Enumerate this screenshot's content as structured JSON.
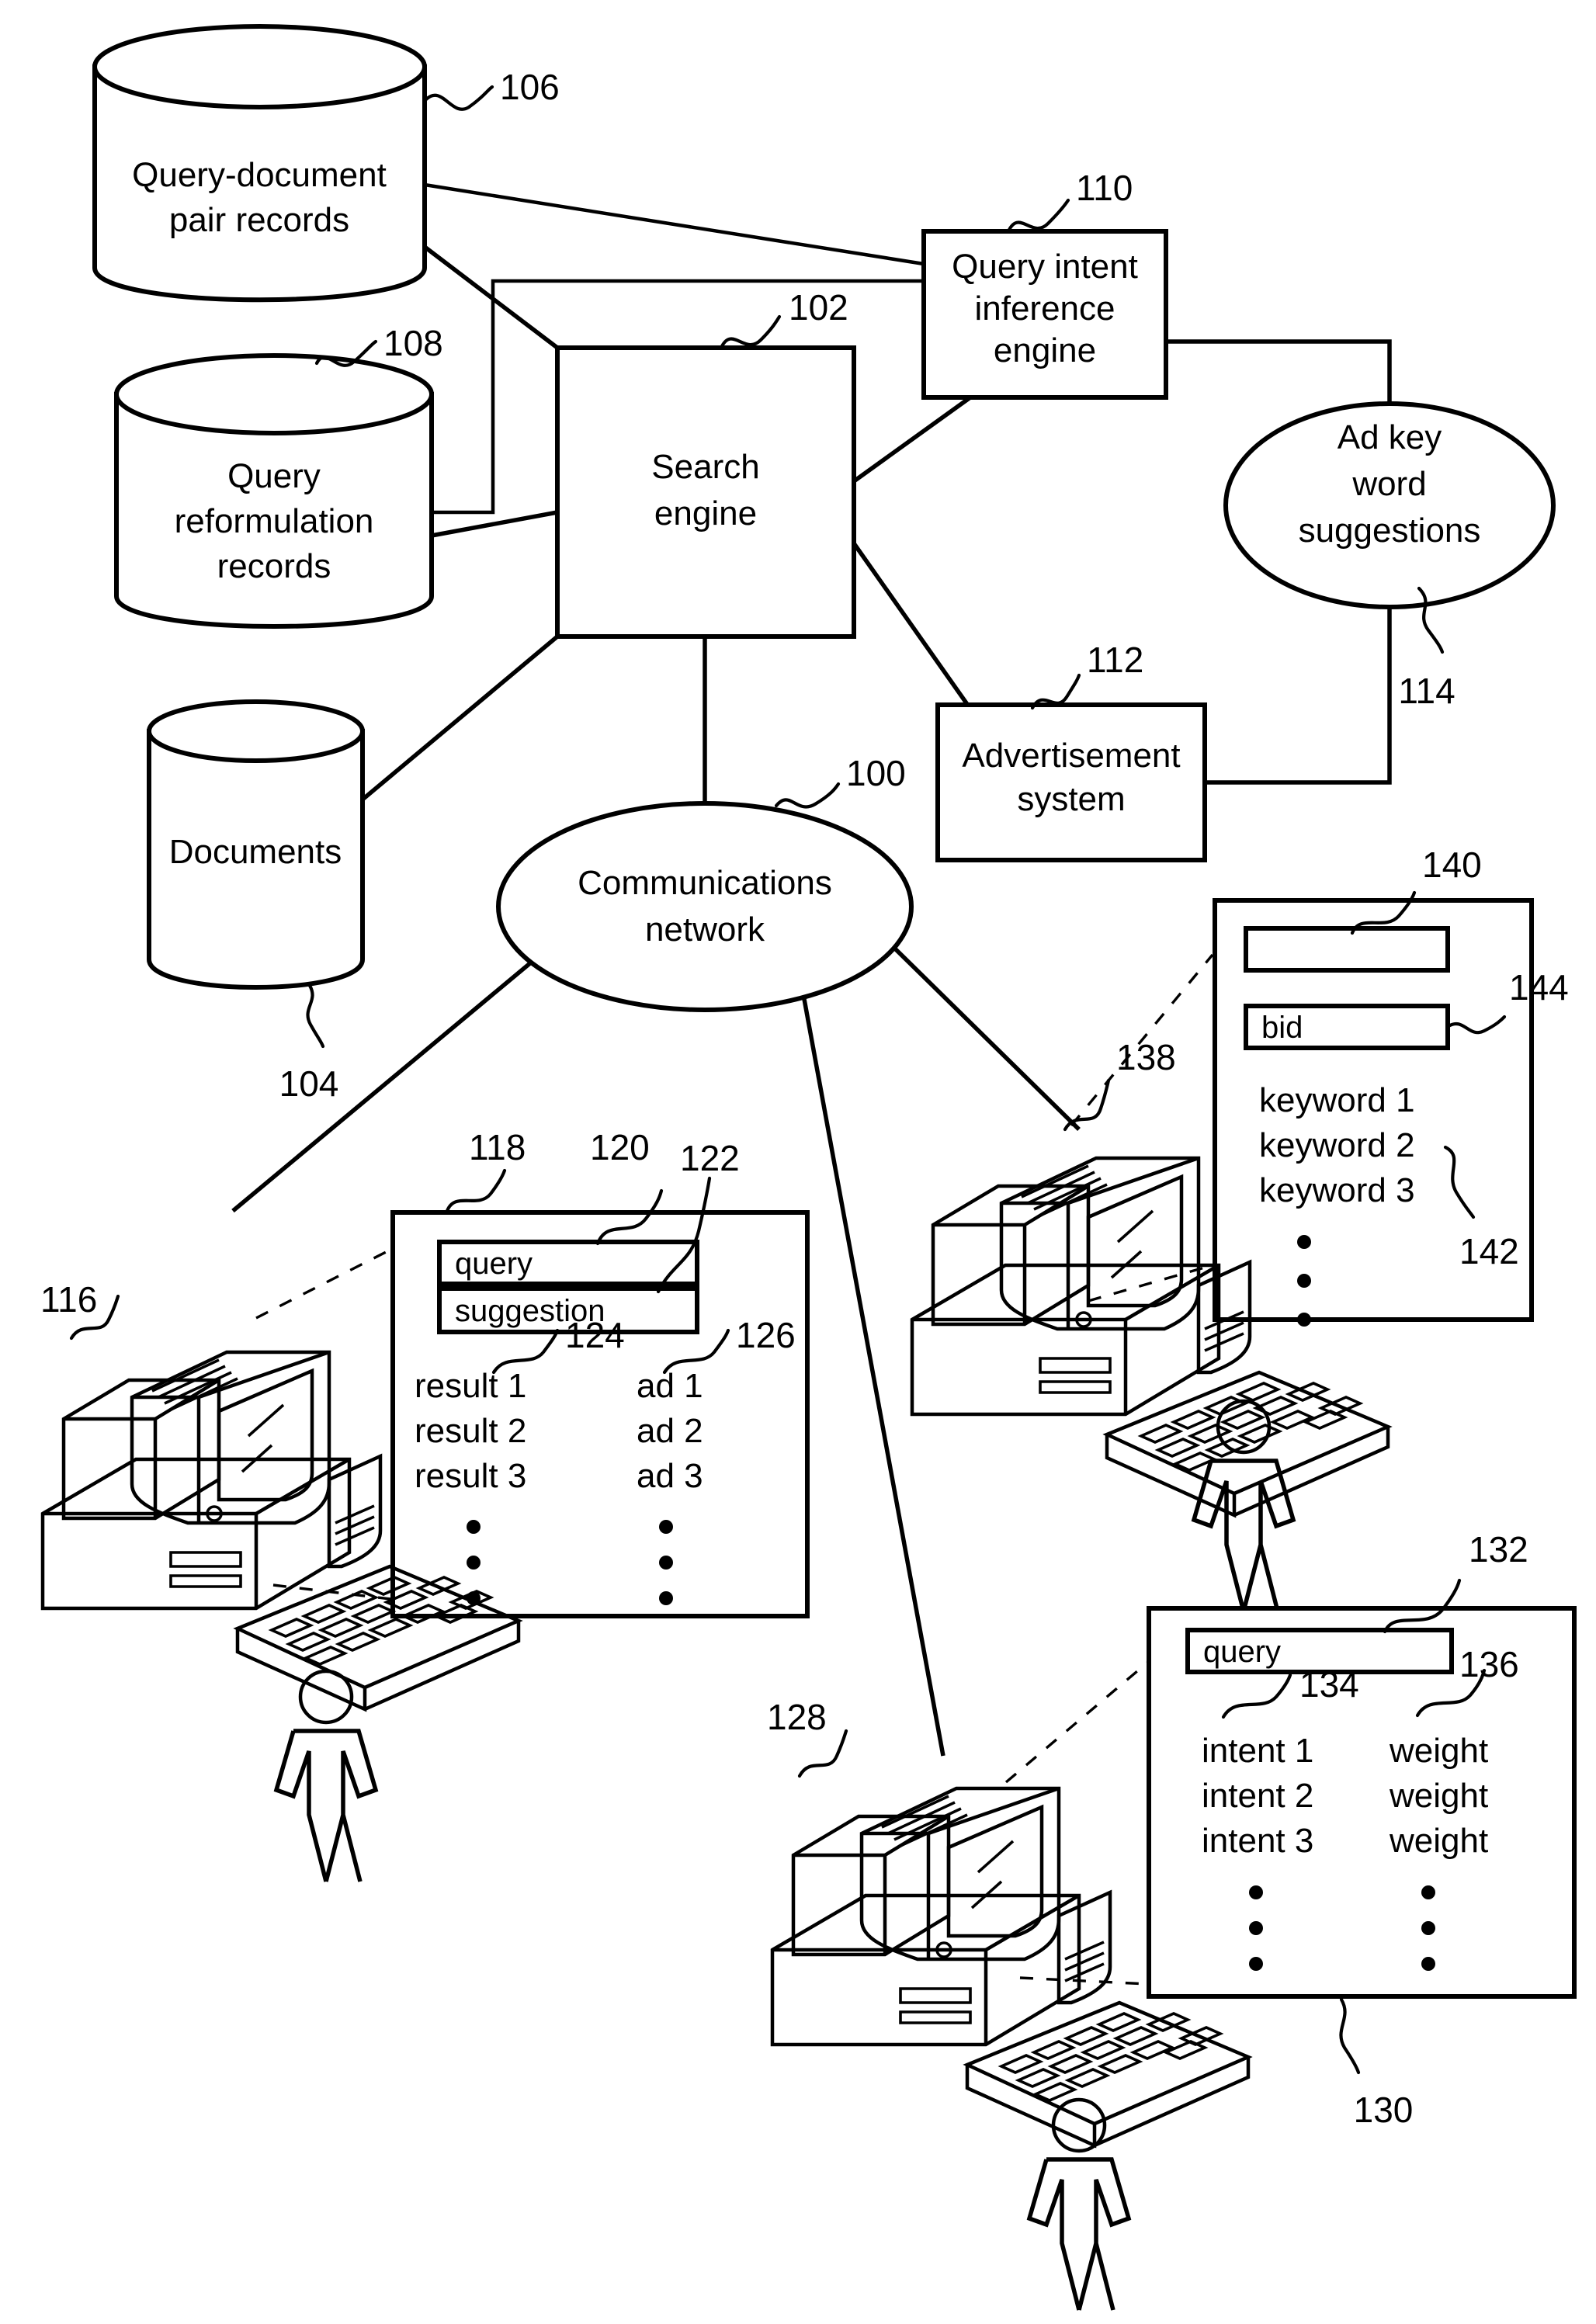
{
  "figure": {
    "kind": "patent-system-diagram",
    "background": "#ffffff",
    "ink": "#000000"
  },
  "nodes": {
    "query_document_store": {
      "label_line1": "Query-document",
      "label_line2": "pair records",
      "ref": "106",
      "shape": "cylinder"
    },
    "query_reformulation_store": {
      "label_line1": "Query",
      "label_line2": "reformulation",
      "label_line3": "records",
      "ref": "108",
      "shape": "cylinder"
    },
    "documents_store": {
      "label_line1": "Documents",
      "ref": "104",
      "shape": "cylinder"
    },
    "search_engine": {
      "label_line1": "Search",
      "label_line2": "engine",
      "ref": "102",
      "shape": "rect"
    },
    "query_intent_engine": {
      "label_line1": "Query intent",
      "label_line2": "inference",
      "label_line3": "engine",
      "ref": "110",
      "shape": "rect"
    },
    "ad_keyword_suggestions": {
      "label_line1": "Ad key",
      "label_line2": "word",
      "label_line3": "suggestions",
      "ref": "114",
      "shape": "ellipse"
    },
    "advertisement_system": {
      "label_line1": "Advertisement",
      "label_line2": "system",
      "ref": "112",
      "shape": "rect"
    },
    "communications_network": {
      "label_line1": "Communications",
      "label_line2": "network",
      "ref": "100",
      "shape": "ellipse"
    }
  },
  "clients": {
    "search_user_workstation": {
      "ref": "116"
    },
    "advertiser_workstation": {
      "ref": "138"
    },
    "intent_workstation": {
      "ref": "128"
    }
  },
  "screens": {
    "search_results_screen": {
      "ref": "118",
      "query_field": {
        "value": "query",
        "ref": "120"
      },
      "suggestion_field": {
        "value": "suggestion",
        "ref": "122"
      },
      "results_column": {
        "ref": "124",
        "items": [
          "result 1",
          "result 2",
          "result 3"
        ],
        "continuation": "vertical-ellipsis"
      },
      "ads_column": {
        "ref": "126",
        "items": [
          "ad 1",
          "ad 2",
          "ad 3"
        ],
        "continuation": "vertical-ellipsis"
      }
    },
    "advertiser_screen": {
      "ref": "140",
      "blank_field": {
        "value": "",
        "ref": "140"
      },
      "bid_field": {
        "value": "bid",
        "ref": "144"
      },
      "keywords_column": {
        "ref": "142",
        "items": [
          "keyword 1",
          "keyword 2",
          "keyword 3"
        ],
        "continuation": "vertical-ellipsis"
      }
    },
    "intent_screen": {
      "ref": "130",
      "query_field": {
        "value": "query",
        "ref": "132"
      },
      "intents_column": {
        "ref": "134",
        "items": [
          "intent 1",
          "intent 2",
          "intent 3"
        ],
        "continuation": "vertical-ellipsis"
      },
      "weights_column": {
        "ref": "136",
        "items": [
          "weight",
          "weight",
          "weight"
        ],
        "continuation": "vertical-ellipsis"
      }
    }
  },
  "reference_numerals": [
    "100",
    "102",
    "104",
    "106",
    "108",
    "110",
    "112",
    "114",
    "116",
    "118",
    "120",
    "122",
    "124",
    "126",
    "128",
    "130",
    "132",
    "134",
    "136",
    "138",
    "140",
    "142",
    "144"
  ]
}
